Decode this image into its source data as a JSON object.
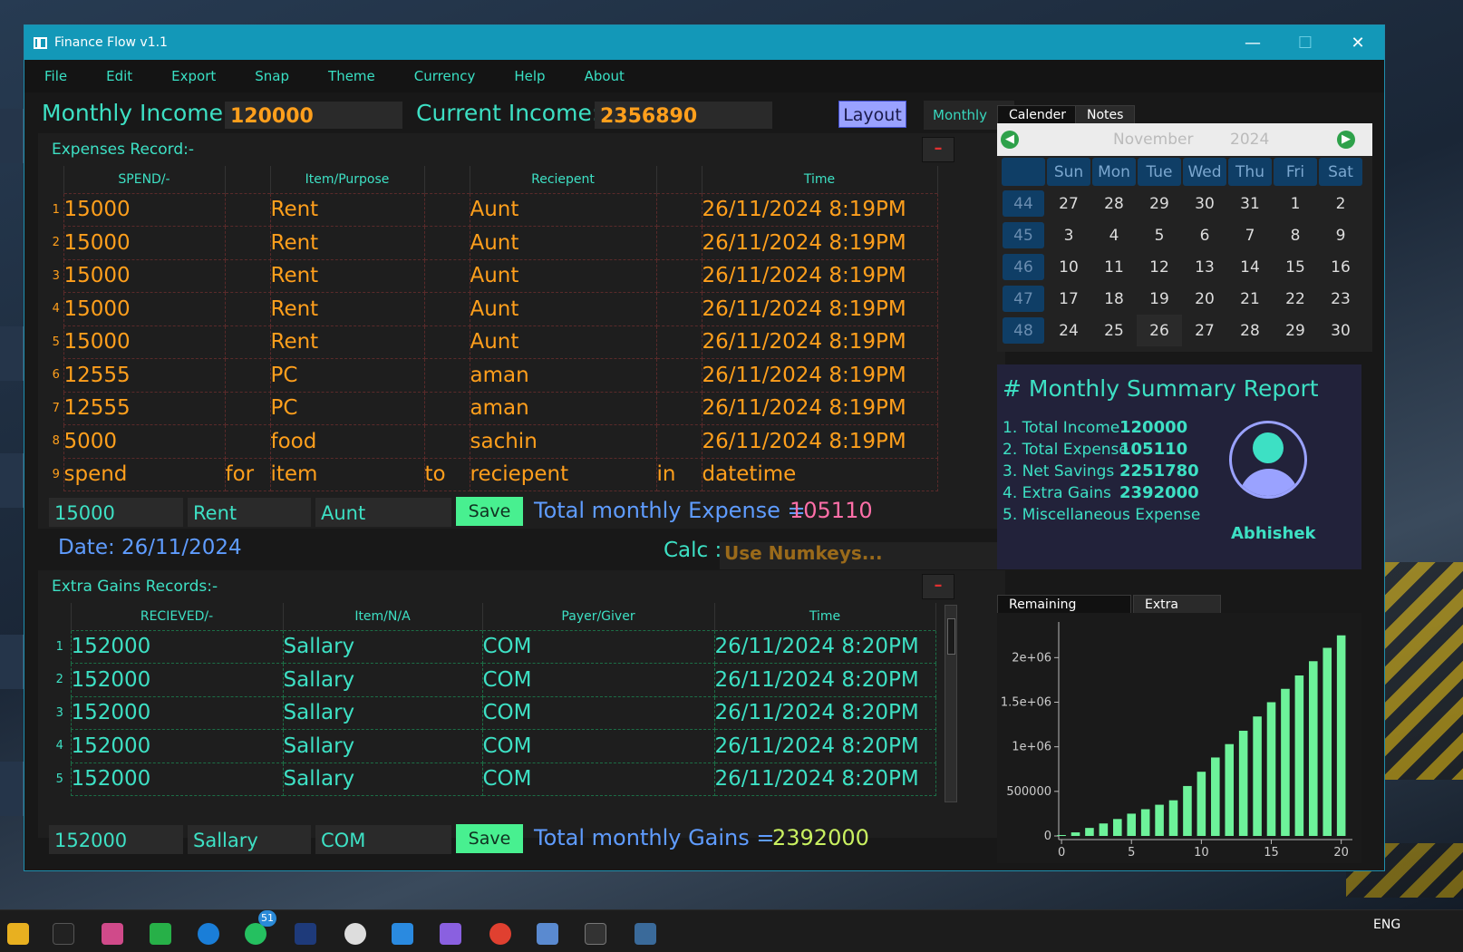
{
  "window": {
    "title": "Finance Flow v1.1",
    "minimize_label": "—",
    "maximize_label": "☐",
    "close_label": "✕"
  },
  "menu": [
    "File",
    "Edit",
    "Export",
    "Snap",
    "Theme",
    "Currency",
    "Help",
    "About"
  ],
  "topbar": {
    "monthly_income_label": "Monthly Income:",
    "monthly_income_value": "120000",
    "current_income_label": "Current Income:",
    "current_income_value": "2356890",
    "layout_button": "Layout",
    "period_select": "Monthly"
  },
  "expenses": {
    "title": "Expenses Record:-",
    "minus_label": "–",
    "columns": [
      "SPEND/-",
      "",
      "Item/Purpose",
      "",
      "Reciepent",
      "",
      "Time"
    ],
    "rows": [
      [
        "1",
        "15000",
        "",
        "Rent",
        "",
        "Aunt",
        "",
        "26/11/2024 8:19PM"
      ],
      [
        "2",
        "15000",
        "",
        "Rent",
        "",
        "Aunt",
        "",
        "26/11/2024 8:19PM"
      ],
      [
        "3",
        "15000",
        "",
        "Rent",
        "",
        "Aunt",
        "",
        "26/11/2024 8:19PM"
      ],
      [
        "4",
        "15000",
        "",
        "Rent",
        "",
        "Aunt",
        "",
        "26/11/2024 8:19PM"
      ],
      [
        "5",
        "15000",
        "",
        "Rent",
        "",
        "Aunt",
        "",
        "26/11/2024 8:19PM"
      ],
      [
        "6",
        "12555",
        "",
        "PC",
        "",
        "aman",
        "",
        "26/11/2024 8:19PM"
      ],
      [
        "7",
        "12555",
        "",
        "PC",
        "",
        "aman",
        "",
        "26/11/2024 8:19PM"
      ],
      [
        "8",
        "5000",
        "",
        "food",
        "",
        "sachin",
        "",
        "26/11/2024 8:19PM"
      ],
      [
        "9",
        "spend",
        "for",
        "item",
        "to",
        "reciepent",
        "in",
        "datetime"
      ]
    ],
    "entry_amount": "15000",
    "entry_item": "Rent",
    "entry_recipient": "Aunt",
    "save_label": "Save",
    "total_label": "Total monthly Expense  =",
    "total_value": "105110"
  },
  "date_label": "Date: 26/11/2024",
  "calc": {
    "label": "Calc :",
    "value": "Use Numkeys..."
  },
  "gains": {
    "title": "Extra Gains Records:-",
    "minus_label": "–",
    "columns": [
      "RECIEVED/-",
      "Item/N/A",
      "Payer/Giver",
      "Time"
    ],
    "rows": [
      [
        "1",
        "152000",
        "Sallary",
        "COM",
        "26/11/2024 8:20PM"
      ],
      [
        "2",
        "152000",
        "Sallary",
        "COM",
        "26/11/2024 8:20PM"
      ],
      [
        "3",
        "152000",
        "Sallary",
        "COM",
        "26/11/2024 8:20PM"
      ],
      [
        "4",
        "152000",
        "Sallary",
        "COM",
        "26/11/2024 8:20PM"
      ],
      [
        "5",
        "152000",
        "Sallary",
        "COM",
        "26/11/2024 8:20PM"
      ]
    ],
    "entry_amount": "152000",
    "entry_item": "Sallary",
    "entry_payer": "COM",
    "save_label": "Save",
    "total_label": "Total monthly Gains  =",
    "total_value": "2392000"
  },
  "calendar": {
    "tabs": [
      "Calender",
      "Notes"
    ],
    "month": "November",
    "year": "2024",
    "day_headers": [
      "Sun",
      "Mon",
      "Tue",
      "Wed",
      "Thu",
      "Fri",
      "Sat"
    ],
    "weeks": [
      {
        "week": "44",
        "days": [
          "27",
          "28",
          "29",
          "30",
          "31",
          "1",
          "2"
        ]
      },
      {
        "week": "45",
        "days": [
          "3",
          "4",
          "5",
          "6",
          "7",
          "8",
          "9"
        ]
      },
      {
        "week": "46",
        "days": [
          "10",
          "11",
          "12",
          "13",
          "14",
          "15",
          "16"
        ]
      },
      {
        "week": "47",
        "days": [
          "17",
          "18",
          "19",
          "20",
          "21",
          "22",
          "23"
        ]
      },
      {
        "week": "48",
        "days": [
          "24",
          "25",
          "26",
          "27",
          "28",
          "29",
          "30"
        ]
      }
    ],
    "today": "26"
  },
  "summary": {
    "title": "# Monthly Summary Report",
    "items": [
      {
        "label": "1. Total Income",
        "value": "120000"
      },
      {
        "label": "2. Total Expense",
        "value": "105110"
      },
      {
        "label": "3. Net Savings",
        "value": "2251780"
      },
      {
        "label": "4. Extra Gains",
        "value": "2392000"
      },
      {
        "label": "5. Miscellaneous Expense",
        "value": ""
      }
    ],
    "username": "Abhishek"
  },
  "chart_tabs": [
    "Remaining income",
    "Extra Gains"
  ],
  "chart_data": {
    "type": "bar",
    "x": [
      0,
      1,
      2,
      3,
      4,
      5,
      6,
      7,
      8,
      9,
      10,
      11,
      12,
      13,
      14,
      15,
      16,
      17,
      18,
      19,
      20
    ],
    "values": [
      0,
      40000,
      90000,
      140000,
      190000,
      250000,
      300000,
      350000,
      400000,
      560000,
      720000,
      880000,
      1030000,
      1180000,
      1340000,
      1500000,
      1650000,
      1800000,
      1960000,
      2110000,
      2250000
    ],
    "xticks": [
      "0",
      "5",
      "10",
      "15",
      "20"
    ],
    "yticks": [
      "0",
      "500000",
      "1e+06",
      "1.5e+06",
      "2e+06"
    ],
    "ylim": [
      0,
      2400000
    ],
    "xlim": [
      -0.2,
      20.8
    ],
    "bar_color": "#6df29a"
  },
  "taskbar": {
    "lang": "ENG",
    "whatsapp_badge": "51"
  }
}
